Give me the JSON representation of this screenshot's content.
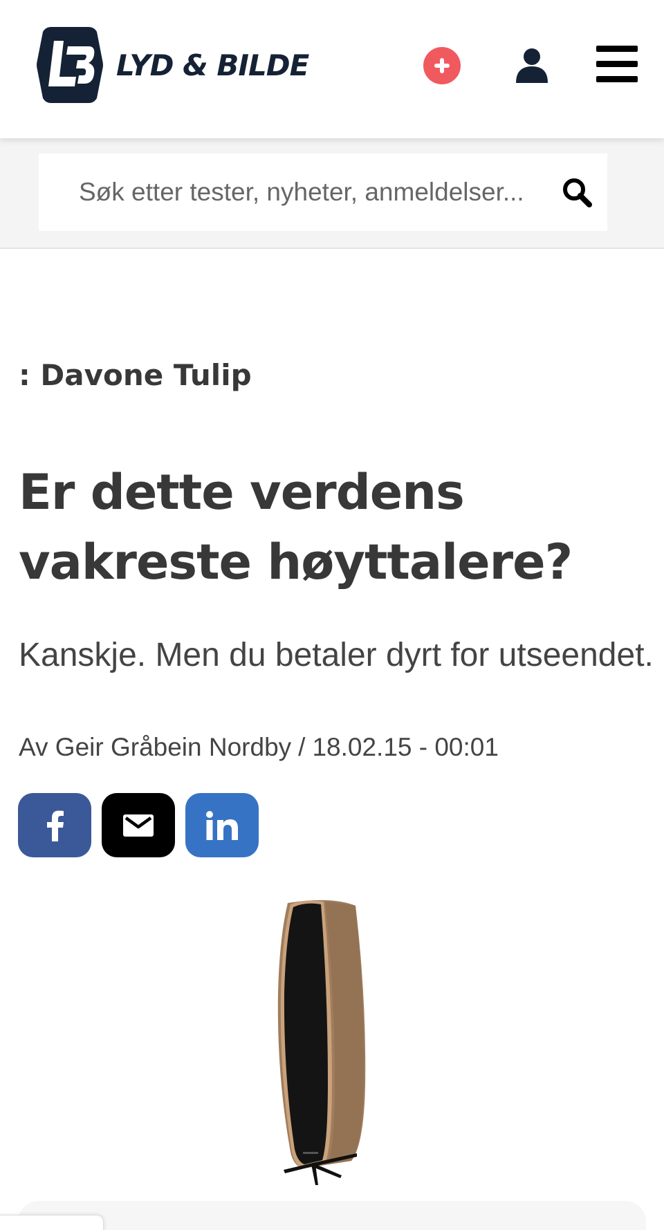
{
  "header": {
    "logo_text": "LYD & BILDE",
    "logo_monogram": "LB",
    "brand_color": "#152236",
    "plus_color": "#f05a5f",
    "icons": [
      "plus-circle-icon",
      "user-icon",
      "hamburger-menu-icon"
    ]
  },
  "search": {
    "placeholder": "Søk etter tester, nyheter, anmeldelser...",
    "icon": "search-icon"
  },
  "article": {
    "kicker": ": Davone Tulip",
    "title": "Er dette verdens vakreste høyttalere?",
    "lead": "Kanskje. Men du betaler dyrt for utseendet.",
    "byline": {
      "prefix": "Av",
      "author": "Geir Gråbein Nordby",
      "separator": "/",
      "date": "18.02.15 - 00:01"
    }
  },
  "share": {
    "buttons": [
      {
        "network": "facebook",
        "icon": "facebook-icon",
        "color": "#3b5998"
      },
      {
        "network": "email",
        "icon": "mail-icon",
        "color": "#000000"
      },
      {
        "network": "linkedin",
        "icon": "linkedin-icon",
        "color": "#3673c4"
      }
    ]
  },
  "hero_image": {
    "subject": "speaker-image",
    "wood_color": "#9a7a5c",
    "front_color": "#141414"
  }
}
